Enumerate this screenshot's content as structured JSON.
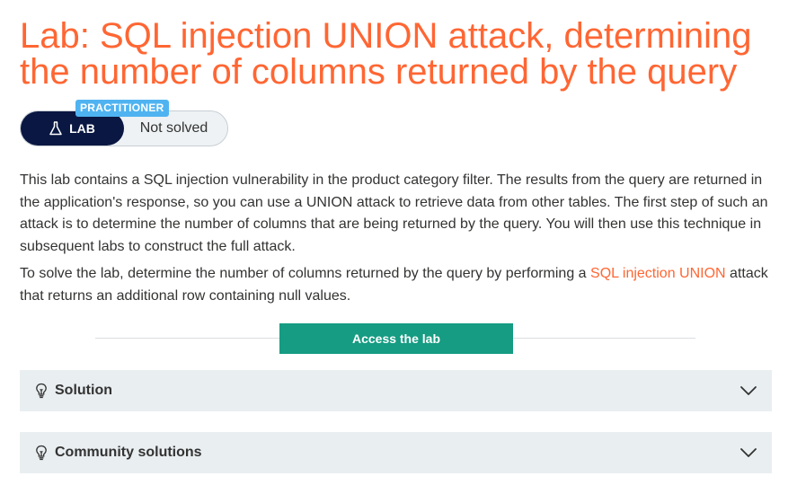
{
  "header": {
    "title": "Lab: SQL injection UNION attack, determining the number of columns returned by the query"
  },
  "badge": {
    "level": "PRACTITIONER",
    "lab_label": "LAB",
    "lab_icon": "flask-icon",
    "status": "Not solved"
  },
  "description": {
    "paragraph1": "This lab contains a SQL injection vulnerability in the product category filter. The results from the query are returned in the application's response, so you can use a UNION attack to retrieve data from other tables. The first step of such an attack is to determine the number of columns that are being returned by the query. You will then use this technique in subsequent labs to construct the full attack.",
    "paragraph2_before": "To solve the lab, determine the number of columns returned by the query by performing a ",
    "paragraph2_link": "SQL injection UNION",
    "paragraph2_after": " attack that returns an additional row containing null values."
  },
  "actions": {
    "access_label": "Access the lab"
  },
  "accordions": [
    {
      "label": "Solution",
      "icon": "lightbulb-icon"
    },
    {
      "label": "Community solutions",
      "icon": "lightbulb-icon"
    }
  ],
  "colors": {
    "accent": "#ff6633",
    "lab_pill": "#0a1742",
    "level_tag": "#4fb3f1",
    "button": "#159c82",
    "accordion_bg": "#e9eef1"
  }
}
